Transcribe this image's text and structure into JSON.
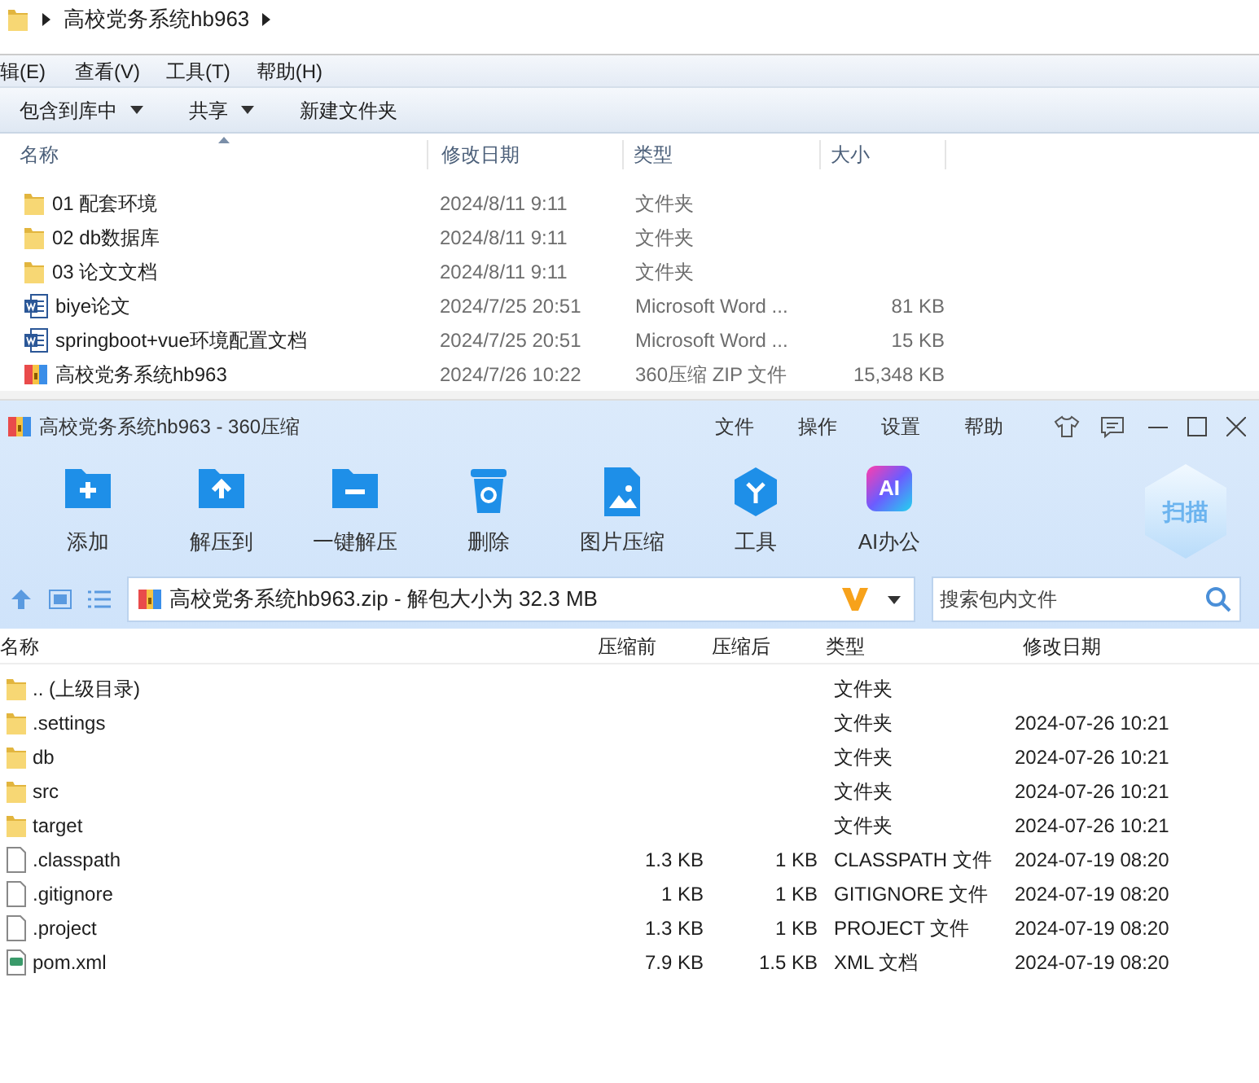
{
  "explorer": {
    "breadcrumb": [
      "高校党务系统hb963"
    ],
    "menu": [
      "辑(E)",
      "查看(V)",
      "工具(T)",
      "帮助(H)"
    ],
    "toolbar": [
      {
        "label": "包含到库中",
        "dropdown": true
      },
      {
        "label": "共享",
        "dropdown": true
      },
      {
        "label": "新建文件夹",
        "dropdown": false
      }
    ],
    "columns": [
      "名称",
      "修改日期",
      "类型",
      "大小"
    ],
    "rows": [
      {
        "kind": "folder",
        "name": "01 配套环境",
        "date": "2024/8/11 9:11",
        "type": "文件夹",
        "size": ""
      },
      {
        "kind": "folder",
        "name": "02 db数据库",
        "date": "2024/8/11 9:11",
        "type": "文件夹",
        "size": ""
      },
      {
        "kind": "folder",
        "name": "03 论文文档",
        "date": "2024/8/11 9:11",
        "type": "文件夹",
        "size": ""
      },
      {
        "kind": "word",
        "name": "biye论文",
        "date": "2024/7/25 20:51",
        "type": "Microsoft Word ...",
        "size": "81 KB"
      },
      {
        "kind": "word",
        "name": "springboot+vue环境配置文档",
        "date": "2024/7/25 20:51",
        "type": "Microsoft Word ...",
        "size": "15 KB"
      },
      {
        "kind": "zip",
        "name": "高校党务系统hb963",
        "date": "2024/7/26 10:22",
        "type": "360压缩 ZIP 文件",
        "size": "15,348 KB"
      }
    ]
  },
  "archiver": {
    "title": "高校党务系统hb963 - 360压缩",
    "menu": [
      "文件",
      "操作",
      "设置",
      "帮助"
    ],
    "tools": [
      {
        "kind": "add",
        "label": "添加"
      },
      {
        "kind": "extract",
        "label": "解压到"
      },
      {
        "kind": "oneclick",
        "label": "一键解压"
      },
      {
        "kind": "delete",
        "label": "删除"
      },
      {
        "kind": "image",
        "label": "图片压缩"
      },
      {
        "kind": "tools",
        "label": "工具"
      },
      {
        "kind": "ai",
        "label": "AI办公",
        "badge": "AI"
      }
    ],
    "scan": "扫描",
    "path": "高校党务系统hb963.zip - 解包大小为 32.3 MB",
    "search": {
      "placeholder": "搜索包内文件"
    },
    "columns": [
      "名称",
      "压缩前",
      "压缩后",
      "类型",
      "修改日期"
    ],
    "rows": [
      {
        "kind": "folder",
        "name": ".. (上级目录)",
        "before": "",
        "after": "",
        "type": "文件夹",
        "date": ""
      },
      {
        "kind": "folder",
        "name": ".settings",
        "before": "",
        "after": "",
        "type": "文件夹",
        "date": "2024-07-26 10:21"
      },
      {
        "kind": "folder",
        "name": "db",
        "before": "",
        "after": "",
        "type": "文件夹",
        "date": "2024-07-26 10:21"
      },
      {
        "kind": "folder",
        "name": "src",
        "before": "",
        "after": "",
        "type": "文件夹",
        "date": "2024-07-26 10:21"
      },
      {
        "kind": "folder",
        "name": "target",
        "before": "",
        "after": "",
        "type": "文件夹",
        "date": "2024-07-26 10:21"
      },
      {
        "kind": "file",
        "name": ".classpath",
        "before": "1.3 KB",
        "after": "1 KB",
        "type": "CLASSPATH 文件",
        "date": "2024-07-19 08:20"
      },
      {
        "kind": "file",
        "name": ".gitignore",
        "before": "1 KB",
        "after": "1 KB",
        "type": "GITIGNORE 文件",
        "date": "2024-07-19 08:20"
      },
      {
        "kind": "file",
        "name": ".project",
        "before": "1.3 KB",
        "after": "1 KB",
        "type": "PROJECT 文件",
        "date": "2024-07-19 08:20"
      },
      {
        "kind": "xml",
        "name": "pom.xml",
        "before": "7.9 KB",
        "after": "1.5 KB",
        "type": "XML 文档",
        "date": "2024-07-19 08:20"
      }
    ]
  }
}
